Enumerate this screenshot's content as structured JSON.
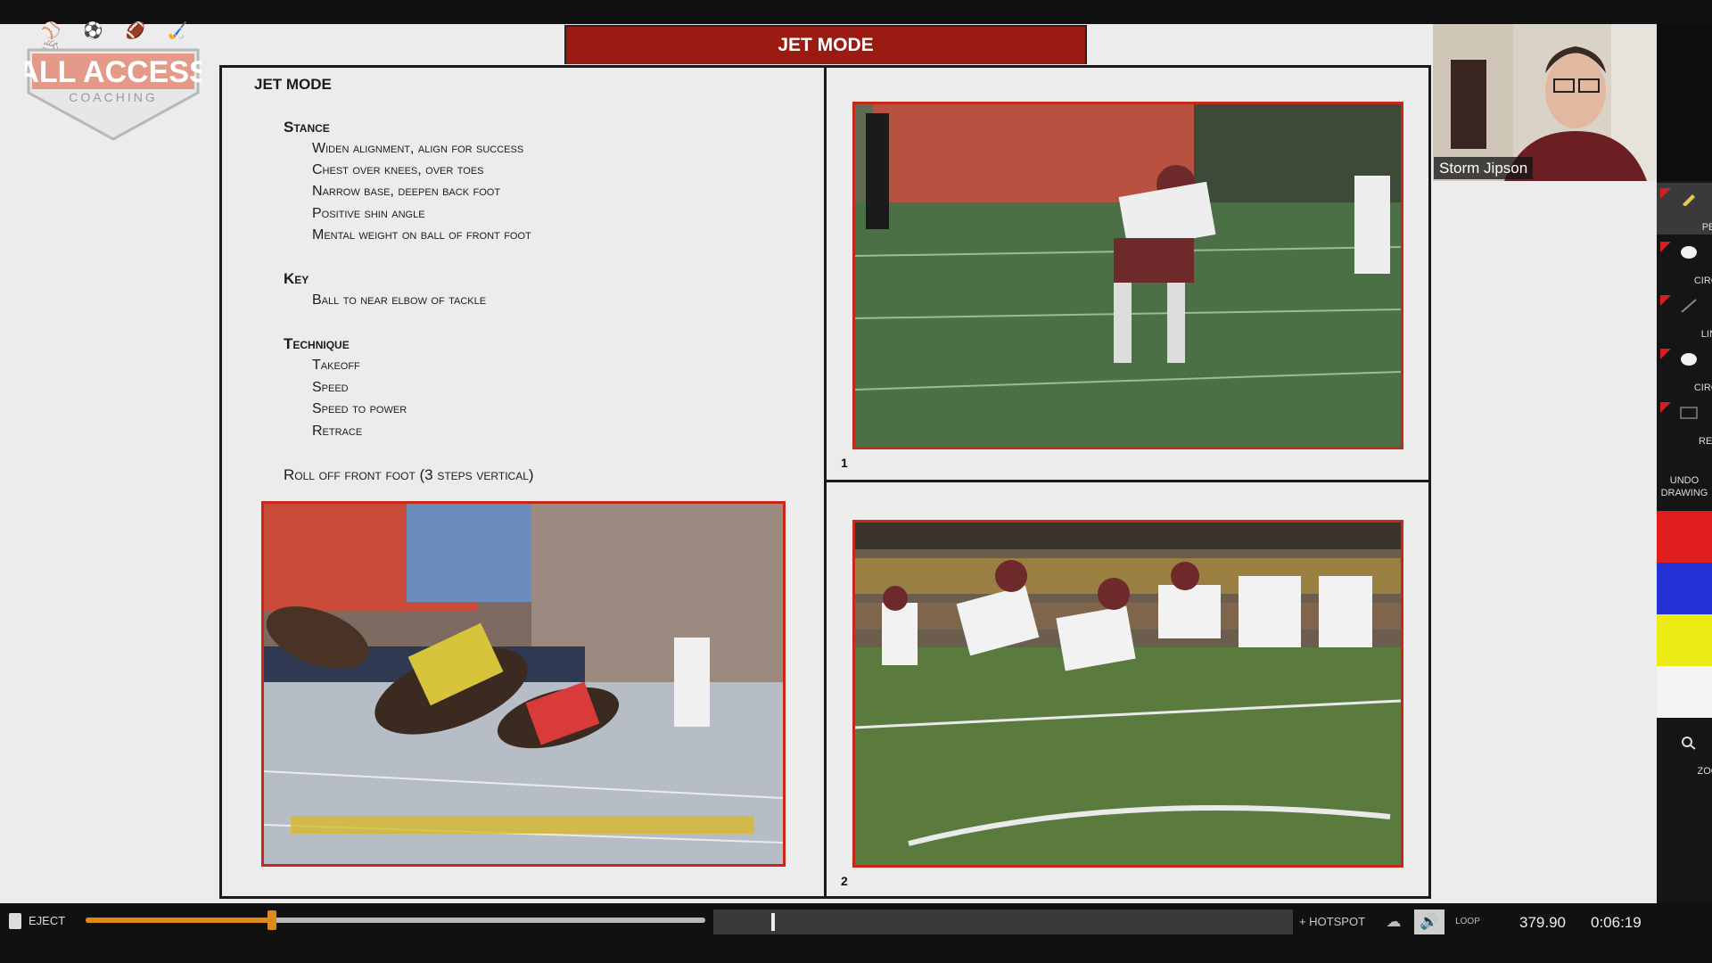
{
  "app": {
    "logo_text_main": "ALL ACCESS",
    "logo_text_sub": "COACHING",
    "logo_icons": "⚾ ⚽ 🏈 🏑 🏐"
  },
  "slide": {
    "title": "JET MODE",
    "header_label": "JET MODE",
    "sections": [
      {
        "heading": "Stance",
        "items": [
          "Widen alignment, align for success",
          "Chest over knees, over toes",
          "Narrow base, deepen back foot",
          "Positive shin angle",
          "Mental weight on ball of front foot"
        ]
      },
      {
        "heading": "Key",
        "items": [
          "Ball to near elbow of tackle"
        ]
      },
      {
        "heading": "Technique",
        "items": [
          "Takeoff",
          "Speed",
          "Speed to power",
          "Retrace"
        ]
      }
    ],
    "footer_line": "Roll off front foot (3 steps vertical)",
    "photo_captions": [
      "1",
      "2"
    ],
    "photo_names": [
      "sprinters-start-photo",
      "football-lineman-stance-photo",
      "football-lineman-takeoff-photo"
    ]
  },
  "webcam": {
    "presenter_name": "Storm Jipson"
  },
  "tools": {
    "items": [
      {
        "label": "PEN",
        "icon": "pencil-icon"
      },
      {
        "label": "CIRCLE",
        "icon": "circle-icon"
      },
      {
        "label": "LINE",
        "icon": "line-icon"
      },
      {
        "label": "CIRCLE",
        "icon": "circle-filled-icon"
      },
      {
        "label": "RECT",
        "icon": "rect-icon"
      }
    ],
    "undo_label_1": "UNDO",
    "undo_label_2": "DRAWING",
    "zoom_label": "ZOOM",
    "colors": [
      "#e01e1e",
      "#2333d6",
      "#ecec14",
      "#f4f4f4"
    ]
  },
  "player": {
    "eject_label": "EJECT",
    "progress_fraction": 0.3,
    "scrub_marker_fraction": 0.1,
    "hotspot_label": "+ HOTSPOT",
    "frame_readout": "379.90",
    "time_readout": "0:06:19",
    "loop_label": "LOOP"
  }
}
